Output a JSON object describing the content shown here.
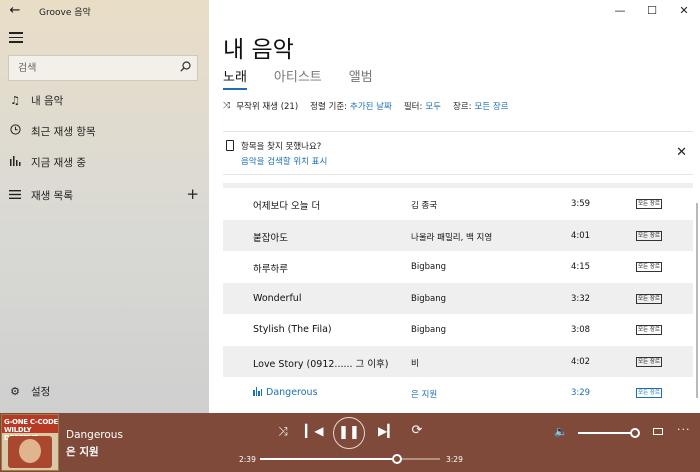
{
  "app": {
    "title": "Groove 음악"
  },
  "sidebar": {
    "search_placeholder": "검색",
    "items": [
      {
        "label": "내 음악",
        "icon": "music-note-icon"
      },
      {
        "label": "최근 재생 항목",
        "icon": "clock-icon"
      },
      {
        "label": "지금 재생 중",
        "icon": "equalizer-icon"
      },
      {
        "label": "재생 목록",
        "icon": "playlist-icon"
      }
    ],
    "settings_label": "설정"
  },
  "main": {
    "title": "내 음악",
    "tabs": [
      {
        "label": "노래",
        "active": true
      },
      {
        "label": "아티스트",
        "active": false
      },
      {
        "label": "앨범",
        "active": false
      }
    ],
    "filters": {
      "shuffle_label": "무작위 재생 (21)",
      "sort_label": "정렬 기준:",
      "sort_value": "추가된 날짜",
      "filter_label": "필터:",
      "filter_value": "모두",
      "genre_label": "장르:",
      "genre_value": "모든 장르"
    },
    "notice": {
      "title": "항목을 찾지 못했나요?",
      "link": "음악을 검색할 위치 표시"
    },
    "tracks": [
      {
        "title": "어제보다 오늘 더",
        "artist": "김 종국",
        "duration": "3:59",
        "genre": "모든 장르",
        "playing": false
      },
      {
        "title": "붙잡아도",
        "artist": "나울라 패밀리, 백 지영",
        "duration": "4:01",
        "genre": "모든 장르",
        "playing": false
      },
      {
        "title": "하루하루",
        "artist": "Bigbang",
        "duration": "4:15",
        "genre": "모든 장르",
        "playing": false
      },
      {
        "title": "Wonderful",
        "artist": "Bigbang",
        "duration": "3:32",
        "genre": "모든 장르",
        "playing": false
      },
      {
        "title": "Stylish (The Fila)",
        "artist": "Bigbang",
        "duration": "3:08",
        "genre": "모든 장르",
        "playing": false
      },
      {
        "title": "Love Story (0912...... 그 이후)",
        "artist": "비",
        "duration": "4:02",
        "genre": "모든 장르",
        "playing": false
      },
      {
        "title": "Dangerous",
        "artist": "은 지원",
        "duration": "3:29",
        "genre": "모든 장르",
        "playing": true
      }
    ]
  },
  "player": {
    "track_title": "Dangerous",
    "track_artist": "은 지원",
    "album_art_text": "G-ONE C-CODE WILDLY DESERVE",
    "current_time": "2:39",
    "total_time": "3:29",
    "progress": 0.76,
    "volume": 1.0
  },
  "colors": {
    "accent": "#1a6fb6",
    "player_bg": "#7f4a3a",
    "row_alt": "#efefef"
  }
}
